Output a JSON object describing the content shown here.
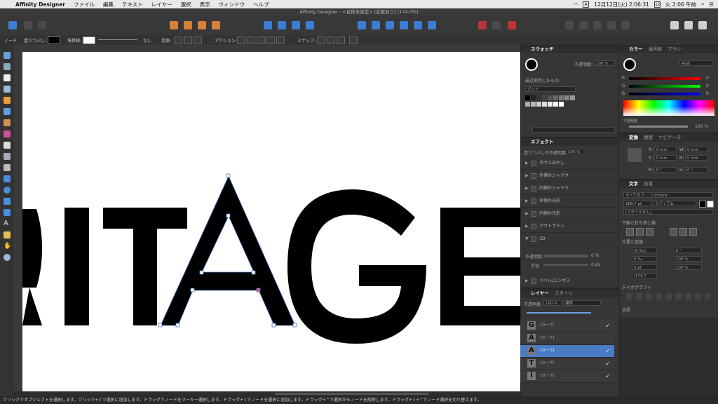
{
  "menubar": {
    "app_name": "Affinity Designer",
    "items": [
      "ファイル",
      "編集",
      "テキスト",
      "レイヤー",
      "選択",
      "表示",
      "ウィンドウ",
      "ヘルプ"
    ],
    "date": "12月12日(火) 2:06:31",
    "clock": "火 2:06 午前",
    "input": "A",
    "cal": "12"
  },
  "window": {
    "title": "Affinity Designer - <名称未設定> [変更あり] (174.0%)"
  },
  "context": {
    "mode": "ノード",
    "fill_label": "塗りつぶし:",
    "stroke_label": "境界線:",
    "stroke_value": "なし",
    "transform_label": "変換:",
    "action_label": "アクション:",
    "snap_label": "スナップ:"
  },
  "canvas": {
    "text": "RITAGE"
  },
  "swatches": {
    "tab": "スウォッチ",
    "opacity_label": "不透明度:",
    "opacity": "100 %",
    "recent_label": "最近使用したもの:",
    "palette": "グレイ"
  },
  "color": {
    "tabs": [
      "カラー",
      "境界線",
      "ブラシ"
    ],
    "model": "RGB",
    "r": "0",
    "g": "0",
    "b": "0",
    "opacity_label": "不透明度",
    "opacity": "100 %"
  },
  "effects": {
    "tab": "エフェクト",
    "fill_opacity_label": "塗りつぶしの不透明度:",
    "fill_opacity": "100 %",
    "items": [
      "ガウスぼかし",
      "外側のシャドウ",
      "内側のシャドウ",
      "外側の光彩",
      "内側の光彩",
      "アウトライン",
      "3D"
    ],
    "opacity_label": "不透明度",
    "opacity_value": "0 %",
    "radius_label": "半径",
    "radius_value": "0 px",
    "bevel": "ベベル/エンボス"
  },
  "transform": {
    "tabs": [
      "変換",
      "履歴",
      "ナビゲータ"
    ],
    "x_label": "X:",
    "x": "0 mm",
    "y_label": "Y:",
    "y": "0 mm",
    "w_label": "W:",
    "w": "0 mm",
    "h_label": "H:",
    "h": "0 mm",
    "r_label": "R:",
    "r": "0 °",
    "s_label": "S:",
    "s": "0 °"
  },
  "character": {
    "tabs": [
      "文字",
      "段落"
    ],
    "family_label": "すべてのフ...",
    "font": "Futura",
    "size": "169.7 pt",
    "weight": "ミディアム",
    "style": "[スタイルなし]",
    "decoration_title": "下線と打ち消し線",
    "position_title": "位置と変換",
    "kern": "(0 ‰)",
    "track": "0 ‰",
    "baseline": "0 pt",
    "leading": "(174.7",
    "rotate": "0 °",
    "hscale": "100 %",
    "vscale": "100 %",
    "typography_title": "タイポグラフィ",
    "language_title": "言語"
  },
  "layers": {
    "tabs": [
      "レイヤー",
      "スタイル"
    ],
    "opacity_label": "不透明度:",
    "opacity": "100 %",
    "blend": "標準",
    "items": [
      {
        "glyph": "G",
        "name": "(カーブ)",
        "visible": "✓"
      },
      {
        "glyph": "A",
        "name": "(カーブ)",
        "visible": ""
      },
      {
        "glyph": "A",
        "name": "(カーブ)",
        "visible": "✓"
      },
      {
        "glyph": "T",
        "name": "(カーブ)",
        "visible": "✓"
      },
      {
        "glyph": "I",
        "name": "(カーブ)",
        "visible": "✓"
      }
    ]
  },
  "status": "クリックでオブジェクトを選択します。クリック+⇧で選択に追加します。ドラッグでノードをマーキー選択します。ドラッグ+⇧でノードを選択に追加します。ドラッグ+^で選択からノードを削除します。ドラッグ+⇧+^でノード選択を切り替えます。"
}
